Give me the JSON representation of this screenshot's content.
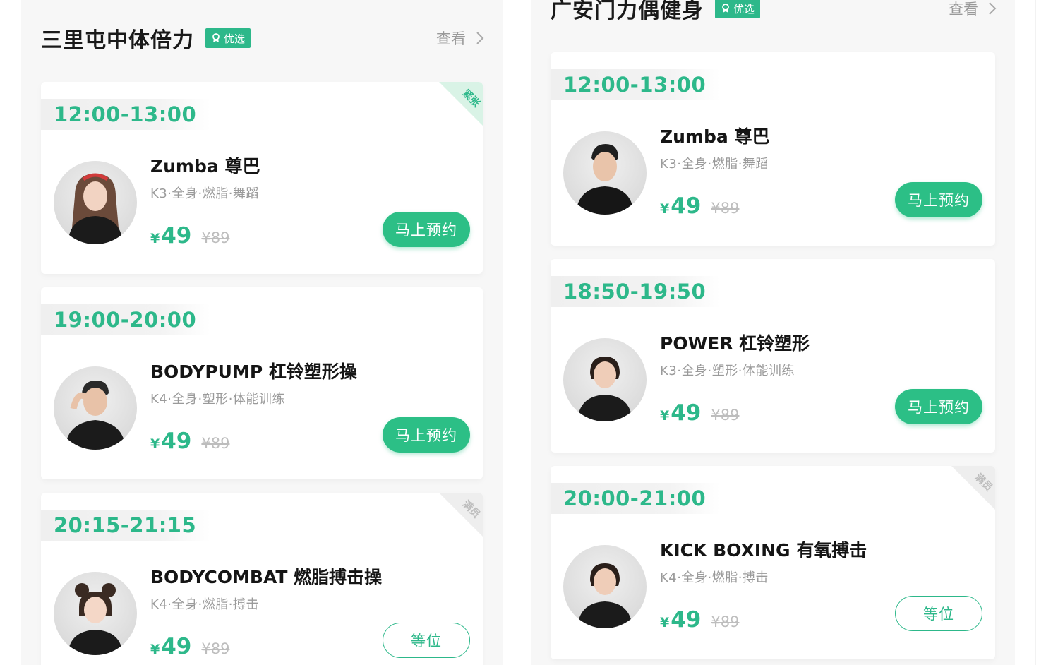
{
  "colors": {
    "accent": "#2db88a",
    "button_green": "#2cbf86",
    "muted_text": "#9a9a9a",
    "old_price": "#bdbdbd"
  },
  "panels": [
    {
      "gym_name": "三里屯中体倍力",
      "badge_label": "优选",
      "view_label": "查看",
      "cards": [
        {
          "time": "12:00-13:00",
          "corner_tag": "紧张",
          "title": "Zumba 尊巴",
          "tags": "K3·全身·燃脂·舞蹈",
          "currency": "¥",
          "price": "49",
          "old_price": "¥89",
          "action": "马上预约",
          "avatar": "female-trainer-avatar"
        },
        {
          "time": "19:00-20:00",
          "title": "BODYPUMP 杠铃塑形操",
          "tags": "K4·全身·塑形·体能训练",
          "currency": "¥",
          "price": "49",
          "old_price": "¥89",
          "action": "马上预约",
          "avatar": "male-trainer-avatar"
        },
        {
          "time": "20:15-21:15",
          "corner_tag": "满员",
          "title": "BODYCOMBAT 燃脂搏击操",
          "tags": "K4·全身·燃脂·搏击",
          "currency": "¥",
          "price": "49",
          "old_price": "¥89",
          "action": "等位",
          "avatar": "female-trainer-avatar"
        }
      ]
    },
    {
      "gym_name": "广安门力偶健身",
      "badge_label": "优选",
      "view_label": "查看",
      "cards": [
        {
          "time": "12:00-13:00",
          "title": "Zumba 尊巴",
          "tags": "K3·全身·燃脂·舞蹈",
          "currency": "¥",
          "price": "49",
          "old_price": "¥89",
          "action": "马上预约",
          "avatar": "male-trainer-avatar"
        },
        {
          "time": "18:50-19:50",
          "title": "POWER 杠铃塑形",
          "tags": "K3·全身·塑形·体能训练",
          "currency": "¥",
          "price": "49",
          "old_price": "¥89",
          "action": "马上预约",
          "avatar": "female-trainer-avatar"
        },
        {
          "time": "20:00-21:00",
          "corner_tag": "满员",
          "title": "KICK BOXING 有氧搏击",
          "tags": "K4·全身·燃脂·搏击",
          "currency": "¥",
          "price": "49",
          "old_price": "¥89",
          "action": "等位",
          "avatar": "female-trainer-avatar"
        }
      ]
    }
  ]
}
